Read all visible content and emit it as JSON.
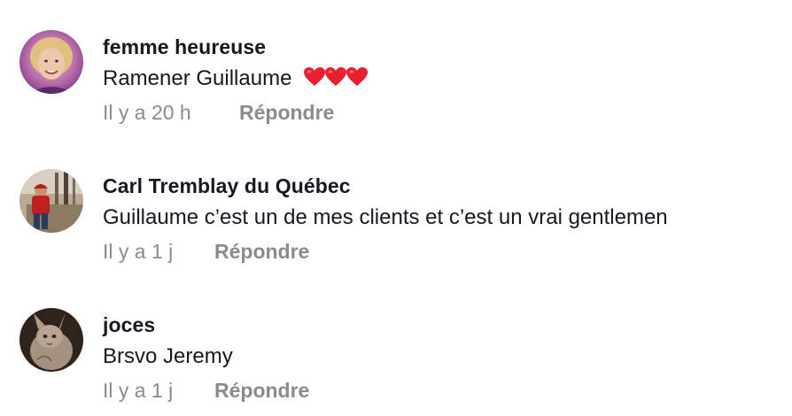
{
  "comments": [
    {
      "username": "femme heureuse",
      "text": "Ramener Guillaume",
      "emoji": "❤️❤️❤️",
      "time": "Il y a 20 h",
      "reply_label": "Répondre"
    },
    {
      "username": "Carl Tremblay du Québec",
      "text": "Guillaume c’est un de mes clients et c’est un vrai gentlemen",
      "time": "Il y a 1 j",
      "reply_label": "Répondre"
    },
    {
      "username": "joces",
      "text": "Brsvo Jeremy",
      "time": "Il y a 1 j",
      "reply_label": "Répondre"
    }
  ],
  "colors": {
    "text_primary": "#161823",
    "text_secondary": "#8a8b91",
    "heart": "#e8202f"
  }
}
